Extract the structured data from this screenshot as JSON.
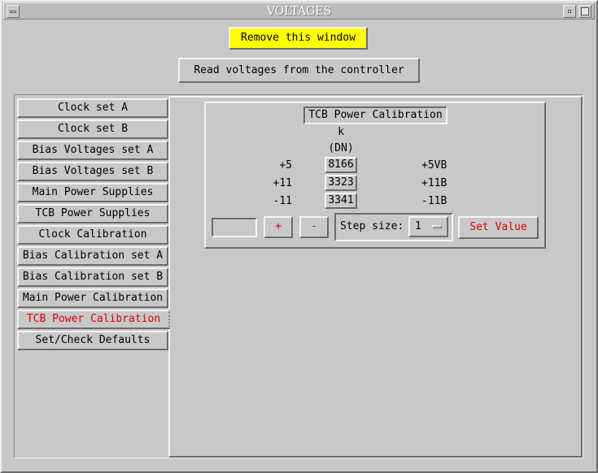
{
  "window": {
    "title": "VOLTAGES",
    "menu_icon": "window-menu-icon",
    "minimize_icon": "minimize-icon",
    "maximize_icon": "maximize-icon"
  },
  "buttons": {
    "remove": "Remove this window",
    "read": "Read voltages from the controller"
  },
  "tabs": [
    {
      "label": "Clock set A"
    },
    {
      "label": "Clock set B"
    },
    {
      "label": "Bias Voltages set A"
    },
    {
      "label": "Bias Voltages set B"
    },
    {
      "label": "Main Power Supplies"
    },
    {
      "label": "TCB Power Supplies"
    },
    {
      "label": "Clock Calibration"
    },
    {
      "label": "Bias Calibration set A"
    },
    {
      "label": "Bias Calibration set B"
    },
    {
      "label": "Main Power Calibration"
    },
    {
      "label": "TCB Power Calibration"
    },
    {
      "label": "Set/Check Defaults"
    }
  ],
  "active_tab_index": 10,
  "calibration": {
    "title": "TCB Power Calibration",
    "column_header": "k",
    "column_unit": "(DN)",
    "rows": [
      {
        "label": "+5",
        "value": "8166",
        "name": "+5VB"
      },
      {
        "label": "+11",
        "value": "3323",
        "name": "+11B"
      },
      {
        "label": "-11",
        "value": "3341",
        "name": "-11B"
      }
    ],
    "input_value": "",
    "plus_label": "+",
    "minus_label": "-",
    "step_label": "Step size:",
    "step_value": "1",
    "set_label": "Set Value"
  },
  "colors": {
    "background": "#c8c8c8",
    "highlight": "#ffff00",
    "accent_text": "#e00000"
  }
}
